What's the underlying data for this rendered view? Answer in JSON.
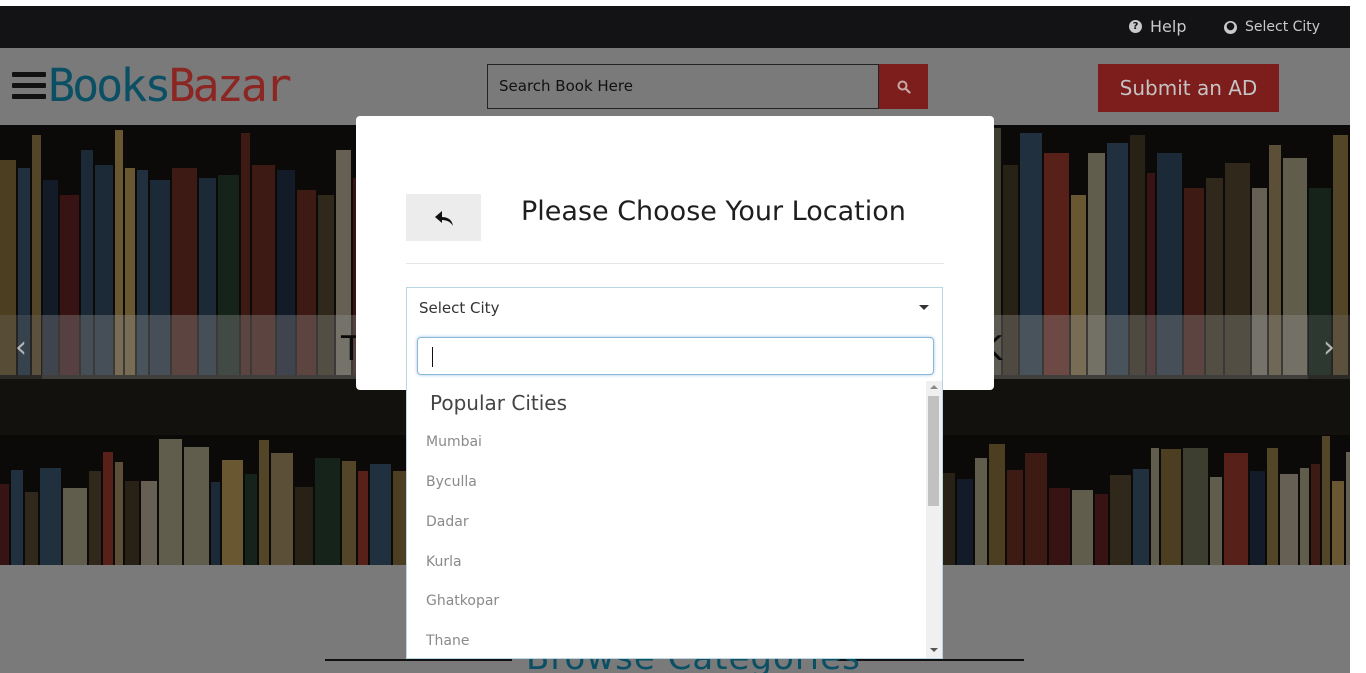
{
  "topbar": {
    "help_label": "Help",
    "help_icon": "question-circle-icon",
    "city_label": "Select City",
    "city_icon": "globe-icon"
  },
  "header": {
    "logo_part1": "Books",
    "logo_part2": "Bazar",
    "search_placeholder": "Search Book Here",
    "submit_ad_label": "Submit an AD"
  },
  "hero": {
    "text_left": "T",
    "text_right": "K",
    "prev_arrow": "‹",
    "next_arrow": "›"
  },
  "section": {
    "browse_title": "Browse Categories"
  },
  "modal": {
    "title": "Please Choose Your Location",
    "back_icon": "reply-arrow-icon",
    "select_value": "Select City",
    "search_value": "",
    "group_label": "Popular Cities",
    "cities": [
      "Mumbai",
      "Byculla",
      "Dadar",
      "Kurla",
      "Ghatkopar",
      "Thane"
    ]
  },
  "colors": {
    "brand_blue": "#0a4f63",
    "brand_red": "#8c2622",
    "button_red": "#7e1e1c",
    "topbar_bg": "#131316"
  }
}
